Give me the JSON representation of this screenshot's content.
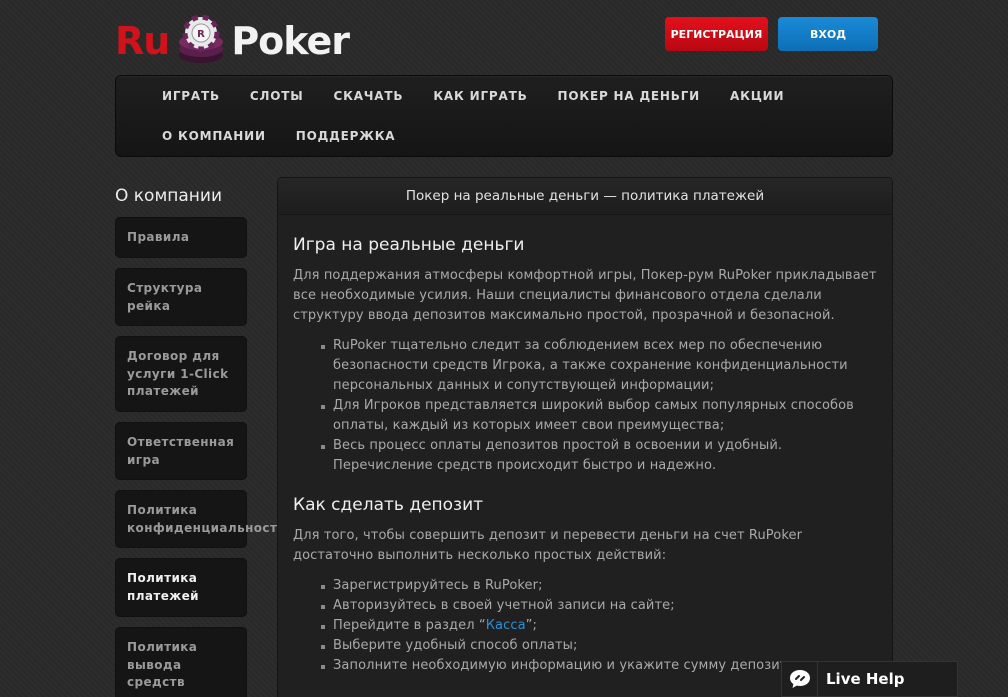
{
  "logo": {
    "ru": "Ru",
    "poker": "Poker"
  },
  "header": {
    "register_label": "РЕГИСТРАЦИЯ",
    "login_label": "ВХОД"
  },
  "nav": {
    "row1": [
      "ИГРАТЬ",
      "СЛОТЫ",
      "СКАЧАТЬ",
      "КАК ИГРАТЬ",
      "ПОКЕР НА ДЕНЬГИ",
      "АКЦИИ"
    ],
    "row2": [
      "О КОМПАНИИ",
      "ПОДДЕРЖКА"
    ]
  },
  "sidebar": {
    "title": "О компании",
    "items": [
      {
        "lines": [
          "Правила"
        ],
        "active": false
      },
      {
        "lines": [
          "Структура",
          "рейка"
        ],
        "active": false
      },
      {
        "lines": [
          "Договор для",
          "услуги 1-Click",
          "платежей"
        ],
        "active": false
      },
      {
        "lines": [
          "Ответственная",
          "игра"
        ],
        "active": false
      },
      {
        "lines": [
          "Политика",
          "конфиденциальности"
        ],
        "active": false
      },
      {
        "lines": [
          "Политика",
          "платежей"
        ],
        "active": true
      },
      {
        "lines": [
          "Политика",
          "вывода",
          "средств"
        ],
        "active": false
      }
    ]
  },
  "content": {
    "header": "Покер на реальные деньги — политика платежей",
    "section1": {
      "title": "Игра на реальные деньги",
      "intro": "Для поддержания атмосферы комфортной игры, Покер-рум RuPoker прикладывает все необходимые усилия. Наши специалисты финансового отдела сделали структуру ввода депозитов максимально простой, прозрачной и безопасной.",
      "bullets": [
        "RuPoker тщательно следит за соблюдением всех мер по обеспечению безопасности средств Игрока, а также сохранение конфиденциальности персональных данных и сопутствующей информации;",
        "Для Игроков представляется широкий выбор самых популярных способов оплаты, каждый из которых имеет свои преимущества;",
        "Весь процесс оплаты депозитов простой в освоении и удобный. Перечисление средств происходит быстро и надежно."
      ]
    },
    "section2": {
      "title": "Как сделать депозит",
      "intro": "Для того, чтобы совершить депозит и перевести деньги на счет RuPoker достаточно выполнить несколько простых действий:",
      "step1": "Зарегистрируйтесь в RuPoker;",
      "step2": "Авторизуйтесь в своей учетной записи на сайте;",
      "step3_prefix": "Перейдите в раздел “",
      "step3_link": "Касса",
      "step3_suffix": "”;",
      "step4": "Выберите удобный способ оплаты;",
      "step5": "Заполните необходимую информацию и укажите сумму депозита."
    }
  },
  "livehelp": {
    "label": "Live Help"
  },
  "colors": {
    "brand_red": "#d0121b",
    "login_blue": "#1a8ad8",
    "link": "#2a8fd6"
  }
}
